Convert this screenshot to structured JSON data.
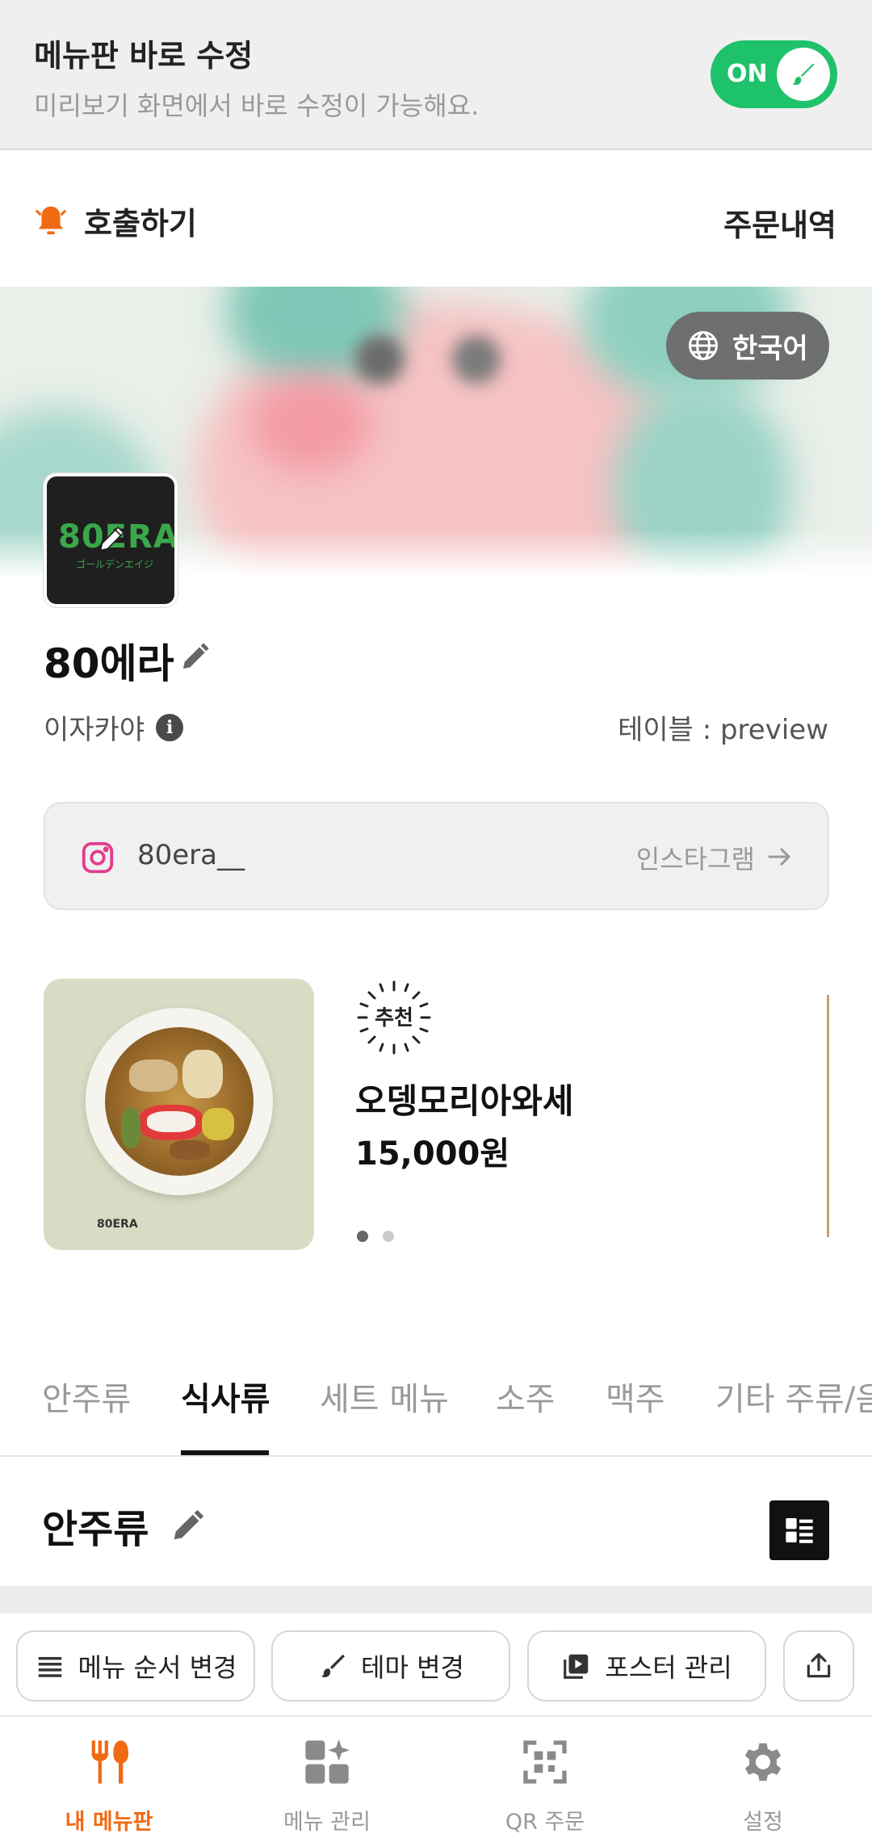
{
  "edit_bar": {
    "title": "메뉴판 바로 수정",
    "subtitle": "미리보기 화면에서 바로 수정이 가능해요.",
    "toggle_label": "ON",
    "toggle_color": "#1ec26a"
  },
  "header": {
    "call_label": "호출하기",
    "call_icon": "bell-icon",
    "orders_label": "주문내역"
  },
  "language": {
    "label": "한국어",
    "icon": "globe-icon"
  },
  "store": {
    "logo_text": "80ERA",
    "logo_sub": "ゴールデンエイジ",
    "name": "80에라",
    "category": "이자카야",
    "table_info": "테이블 : preview"
  },
  "instagram": {
    "handle": "80era__",
    "link_label": "인스타그램"
  },
  "featured": {
    "badge": "추천",
    "name": "오뎅모리아와세",
    "price": "15,000원",
    "image_caption": "80ERA",
    "page_count": 2,
    "current_page": 1
  },
  "tabs": [
    "안주류",
    "식사류",
    "세트 메뉴",
    "소주",
    "맥주",
    "기타 주류/음료"
  ],
  "active_tab": 1,
  "section": {
    "title": "안주류"
  },
  "actions": {
    "reorder_label": "메뉴 순서 변경",
    "theme_label": "테마 변경",
    "poster_label": "포스터 관리"
  },
  "nav": {
    "items": [
      {
        "label": "내 메뉴판",
        "icon": "fork-knife-icon"
      },
      {
        "label": "메뉴 관리",
        "icon": "grid-sparkle-icon"
      },
      {
        "label": "QR 주문",
        "icon": "qr-icon"
      },
      {
        "label": "설정",
        "icon": "gear-icon"
      }
    ],
    "active_index": 0,
    "active_color": "#f06a13"
  }
}
